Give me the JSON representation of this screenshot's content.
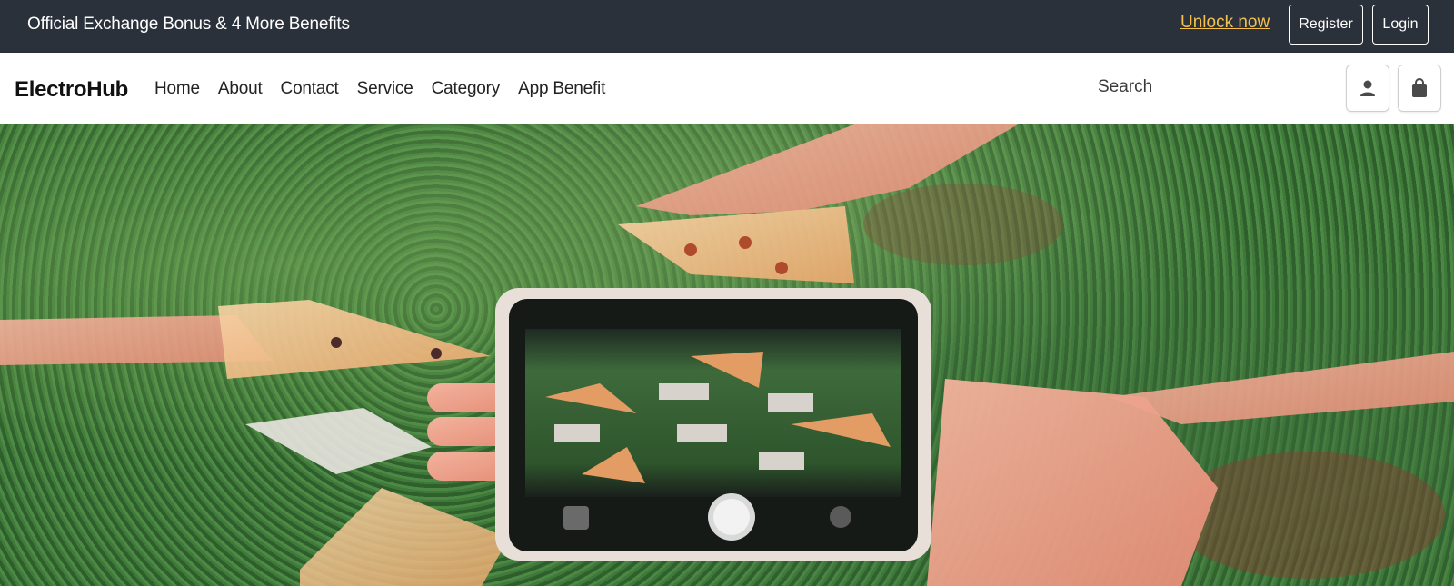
{
  "promo_bar": {
    "message": "Official Exchange Bonus & 4 More Benefits",
    "unlock_label": "Unlock now",
    "register_label": "Register",
    "login_label": "Login",
    "background_color": "#2a313b",
    "unlock_color": "#f3c14b"
  },
  "navbar": {
    "brand": "ElectroHub",
    "links": [
      {
        "label": "Home"
      },
      {
        "label": "About"
      },
      {
        "label": "Contact"
      },
      {
        "label": "Service"
      },
      {
        "label": "Category"
      },
      {
        "label": "App Benefit"
      }
    ],
    "search_placeholder": "Search",
    "account_icon": "user-icon",
    "bag_icon": "shopping-bag-icon"
  },
  "hero": {
    "description_icon": "hero-photo"
  }
}
